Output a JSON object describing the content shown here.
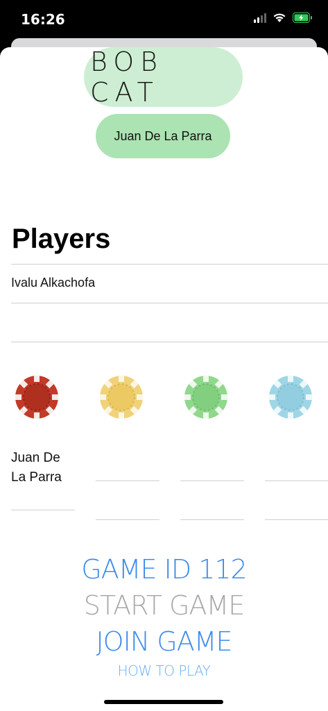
{
  "status_bar": {
    "time": "16:26",
    "icons": [
      "cellular-signal-icon",
      "wifi-icon",
      "battery-charging-icon"
    ],
    "battery_color": "#34c759"
  },
  "header": {
    "title": "BOB CAT",
    "player_button": "Juan De La Parra",
    "title_bg": "#cdeed2",
    "player_bg": "#abe3b2"
  },
  "players": {
    "heading": "Players",
    "list": [
      "Ivalu Alkachofa",
      ""
    ]
  },
  "seats": [
    {
      "chip": "red-poker-chip-icon",
      "color": "#c23a2a",
      "name": "Juan De La Parra"
    },
    {
      "chip": "yellow-poker-chip-icon",
      "color": "#f0d27a",
      "name": ""
    },
    {
      "chip": "green-poker-chip-icon",
      "color": "#8fd88c",
      "name": ""
    },
    {
      "chip": "blue-poker-chip-icon",
      "color": "#9fd6e6",
      "name": ""
    }
  ],
  "menu": {
    "game_id": "GAME ID 112",
    "start_game": "START GAME",
    "join_game": "JOIN GAME",
    "how_to_play": "HOW TO PLAY",
    "active_color": "#3d8be8",
    "disabled_color": "#a9a9a9"
  }
}
